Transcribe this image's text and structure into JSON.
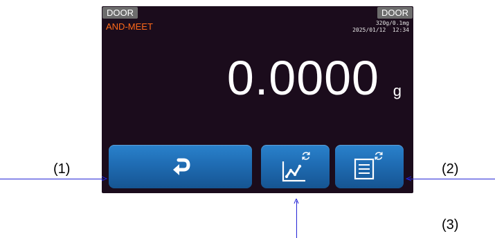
{
  "screen": {
    "door_left": "DOOR",
    "door_right": "DOOR",
    "app_name": "AND-MEET",
    "capacity": "320g/0.1mg",
    "datetime": "2025/01/12  12:34",
    "reading_value": "0.0000",
    "reading_unit": "g"
  },
  "buttons": {
    "back_icon": "return-arrow-icon",
    "graph_icon": "graph-icon",
    "list_icon": "list-icon",
    "refresh_icon": "refresh-icon"
  },
  "annotations": {
    "label_1": "(1)",
    "label_2": "(2)",
    "label_3": "(3)"
  },
  "colors": {
    "screen_bg": "#1b0c1c",
    "accent_orange": "#ff6a1a",
    "button_blue": "#1f6cb3",
    "door_gray": "#6d6d6d",
    "callout_line": "#2323d6"
  }
}
